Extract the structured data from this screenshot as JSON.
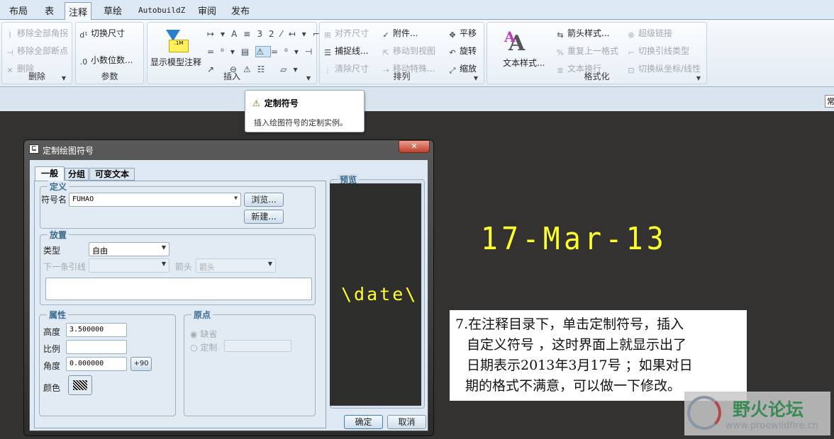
{
  "ribbon_tabs": [
    "布局",
    "表",
    "注释",
    "草绘",
    "AutobuildZ",
    "审阅",
    "发布"
  ],
  "active_tab": "注释",
  "groups": {
    "delete": {
      "label": "删除",
      "items": [
        "移除全部角拐",
        "移除全部断点",
        "删除"
      ]
    },
    "params": {
      "label": "参数",
      "items": [
        "切换尺寸",
        "小数位数..."
      ]
    },
    "insert": {
      "label": "插入",
      "big": "显示模型注释"
    },
    "arrange": {
      "label": "排列",
      "items": [
        "对齐尺寸",
        "捕捉线...",
        "清除尺寸",
        "附件...",
        "移动到视图",
        "移动特殊...",
        "平移",
        "旋转",
        "缩放"
      ]
    },
    "format": {
      "label": "格式化",
      "big": "文本样式...",
      "items": [
        "箭头样式...",
        "重复上一格式",
        "文本换行",
        "超级链接",
        "切换引线类型",
        "切换纵坐标/线性"
      ]
    }
  },
  "tooltip": {
    "title": "定制符号",
    "desc": "插入绘图符号的定制实例。"
  },
  "strip_right": "常",
  "canvas": {
    "date_text": "17-Mar-13"
  },
  "dialog": {
    "title": "定制绘图符号",
    "tabs": [
      "一般",
      "分组",
      "可变文本"
    ],
    "definition": {
      "title": "定义",
      "symbol_label": "符号名",
      "symbol_value": "FUHAO",
      "browse": "浏览...",
      "new": "新建..."
    },
    "placement": {
      "title": "放置",
      "type_label": "类型",
      "type_value": "自由",
      "next_leader": "下一条引线",
      "arrow_label": "箭头",
      "arrow_value": "箭头"
    },
    "attributes": {
      "title": "属性",
      "height_label": "高度",
      "height_value": "3.500000",
      "scale_label": "比例",
      "scale_value": "",
      "angle_label": "角度",
      "angle_value": "0.000000",
      "rot_btn": "+90",
      "color_label": "颜色"
    },
    "origin": {
      "title": "原点",
      "default": "缺省",
      "custom": "定制"
    },
    "preview": {
      "title": "预览",
      "text": "\\date\\"
    },
    "ok": "确定",
    "cancel": "取消"
  },
  "annotation": {
    "lines": [
      "7.在注释目录下，单击定制符号，插入",
      "自定义符号 ，这时界面上就显示出了",
      "日期表示2013年3月17号 ；如果对日",
      "期的格式不满意，可以做一下修改。"
    ]
  },
  "watermark": {
    "name": "野火论坛",
    "url": "www.proewildfire.cn"
  }
}
